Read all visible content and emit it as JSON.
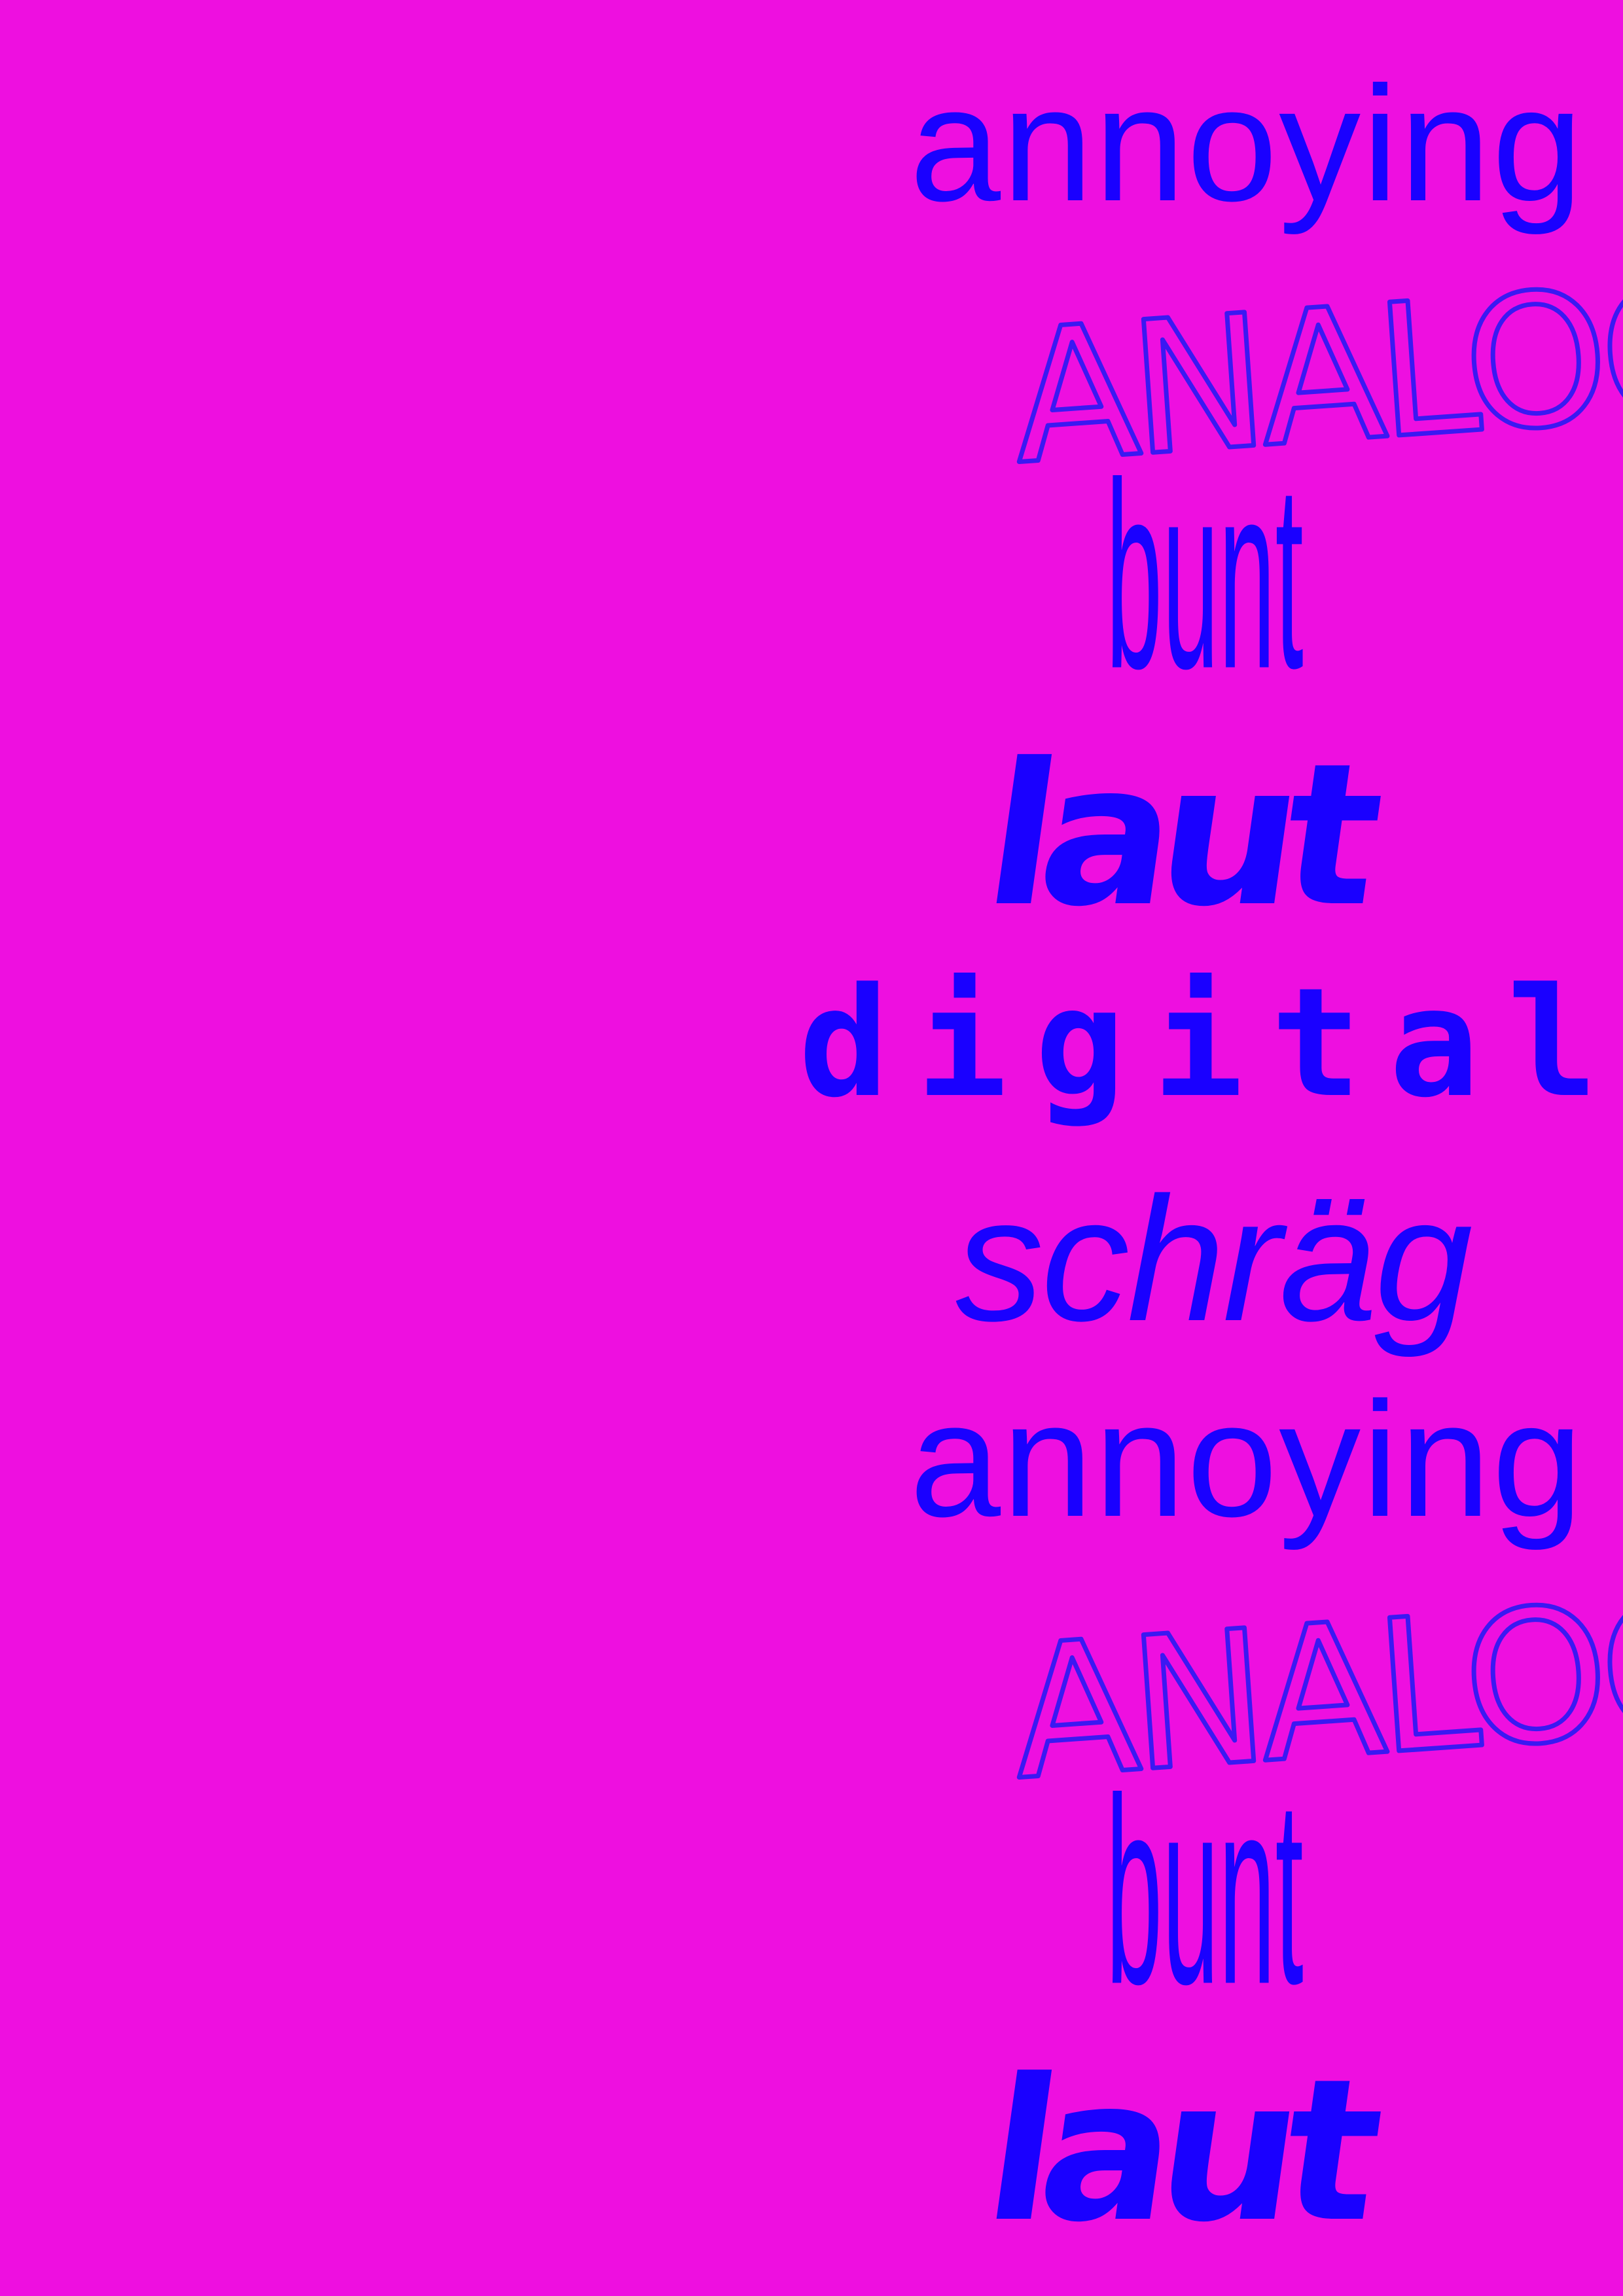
{
  "poster": {
    "background_color": "#ee0fe0",
    "text_color": "#1a00ff",
    "words": [
      "annoying",
      "ANALOG",
      "bunt",
      "laut",
      "digital",
      "schräg",
      "annoying",
      "ANALOG",
      "bunt",
      "laut"
    ]
  }
}
